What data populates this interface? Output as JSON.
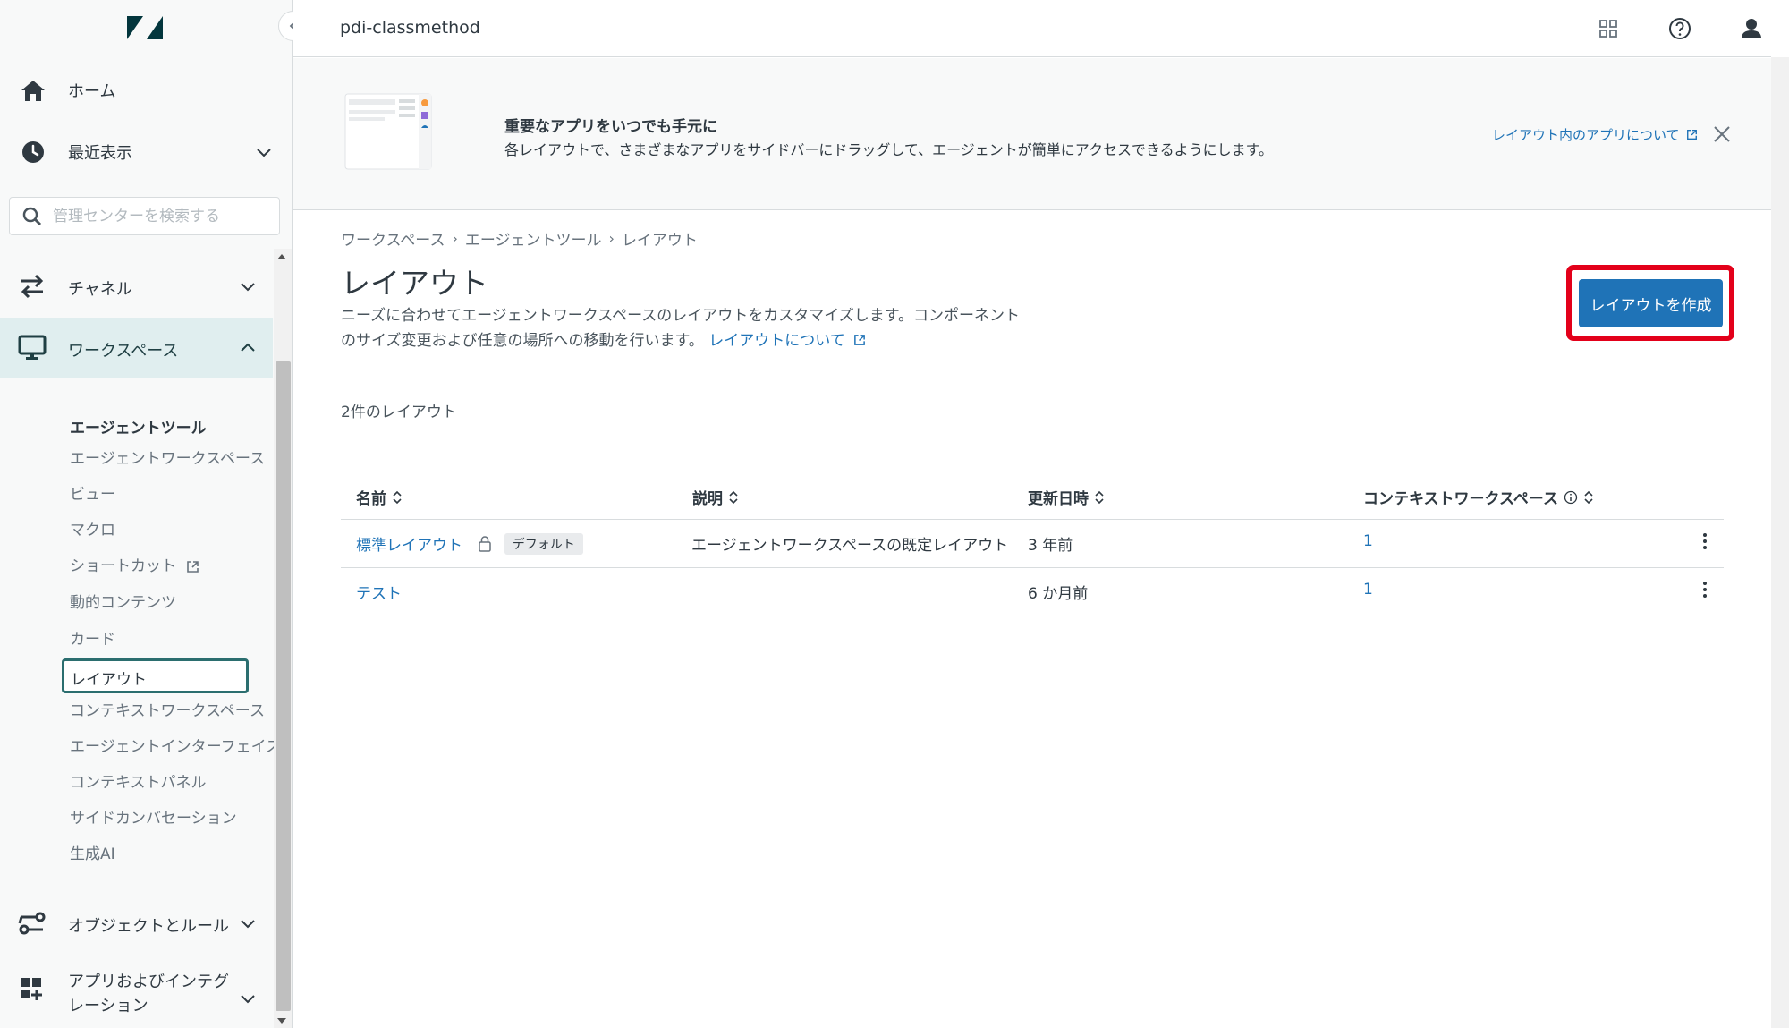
{
  "sidebar": {
    "home": "ホーム",
    "recent": "最近表示",
    "search_placeholder": "管理センターを検索する",
    "channels": "チャネル",
    "workspace": "ワークスペース",
    "sub_heading": "エージェントツール",
    "sub_items": [
      "エージェントワークスペース",
      "ビュー",
      "マクロ",
      "ショートカット",
      "動的コンテンツ",
      "カード",
      "レイアウト",
      "コンテキストワークスペース",
      "エージェントインターフェイス",
      "コンテキストパネル",
      "サイドカンバセーション",
      "生成AI"
    ],
    "objects_rules": "オブジェクトとルール",
    "apps_integrations": "アプリおよびインテグレーション"
  },
  "topbar": {
    "tenant": "pdi-classmethod",
    "icons": [
      "products-grid-icon",
      "help-icon",
      "user-icon"
    ]
  },
  "banner": {
    "title": "重要なアプリをいつでも手元に",
    "description": "各レイアウトで、さまざまなアプリをサイドバーにドラッグして、エージェントが簡単にアクセスできるようにします。",
    "link": "レイアウト内のアプリについて"
  },
  "breadcrumb": [
    "ワークスペース",
    "エージェントツール",
    "レイアウト"
  ],
  "page": {
    "title": "レイアウト",
    "description": "ニーズに合わせてエージェントワークスペースのレイアウトをカスタマイズします。コンポーネントのサイズ変更および任意の場所への移動を行います。",
    "description_link": "レイアウトについて",
    "create_button": "レイアウトを作成",
    "count_label": "2件のレイアウト"
  },
  "table": {
    "headers": [
      "名前",
      "説明",
      "更新日時",
      "コンテキストワークスペース"
    ],
    "rows": [
      {
        "name": "標準レイアウト",
        "badge": "デフォルト",
        "description": "エージェントワークスペースの既定レイアウト",
        "updated": "3 年前",
        "context": "1"
      },
      {
        "name": "テスト",
        "description": "",
        "updated": "6 か月前",
        "context": "1"
      }
    ]
  },
  "colors": {
    "accent": "#1f73b7",
    "active_nav_bg": "#e0eeef",
    "active_border": "#2b6e6f",
    "highlight": "#e3001a"
  }
}
